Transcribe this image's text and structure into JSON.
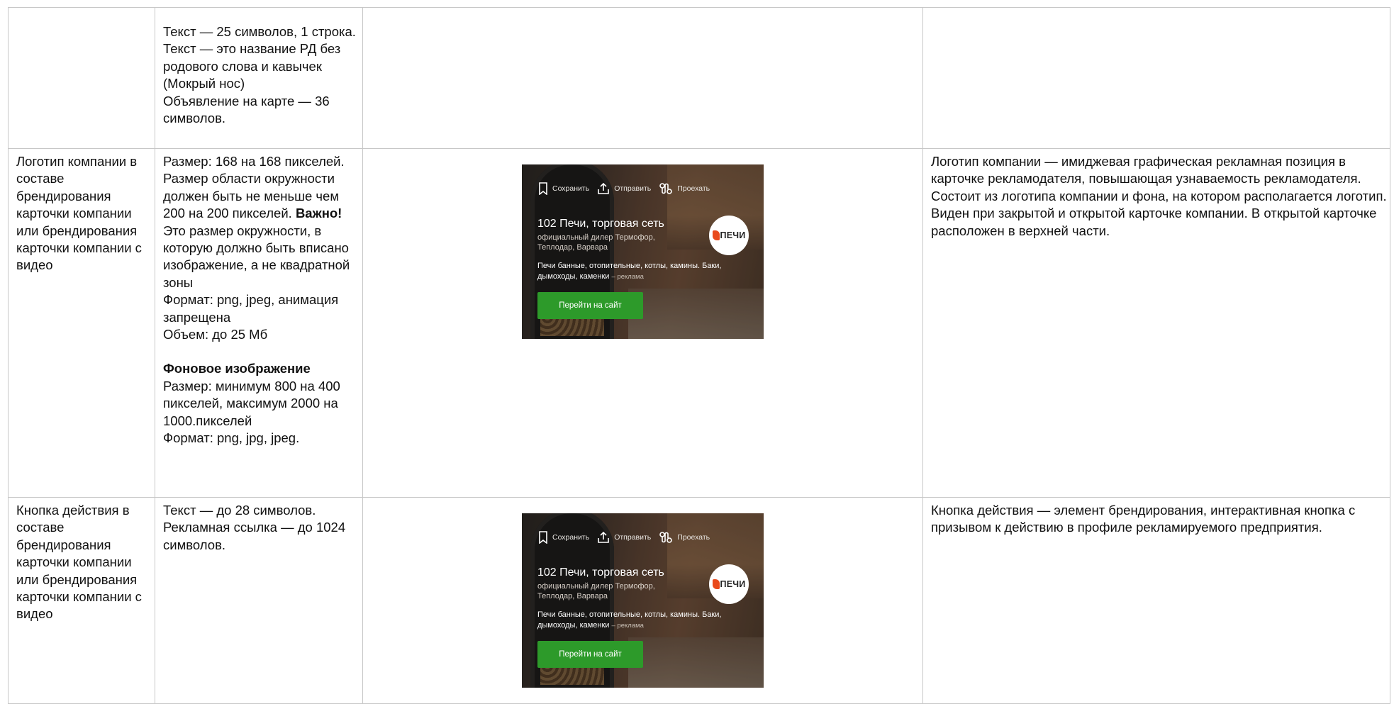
{
  "rows": [
    {
      "col1": "",
      "col2": [
        "Текст — 25 символов, 1 строка. Текст — это название РД без родового слова и кавычек (Мокрый нос)",
        "Объявление на карте — 36 символов."
      ],
      "col4": ""
    },
    {
      "col1": "Логотип компании в составе брендирования карточки компании или брендирования карточки компании с видео",
      "col2": {
        "p1_a": "Размер: 168 на 168 пикселей. Размер области окружности должен быть не меньше чем 200 на 200 пикселей. ",
        "p1_bold": "Важно!",
        "p1_b": " Это размер окружности, в которую должно быть вписано изображение, а не квадратной зоны",
        "p2": "Формат: png, jpeg, анимация запрещена",
        "p3": "Объем: до 25 Мб",
        "bg_heading": "Фоновое изображение",
        "bg_size": "Размер: минимум 800 на 400 пикселей, максимум 2000 на 1000.пикселей",
        "bg_format": "Формат: png, jpg, jpeg."
      },
      "col4": "Логотип компании — имиджевая графическая рекламная позиция в карточке рекламодателя, повышающая узнаваемость рекламодателя. Состоит из логотипа компании и фона, на котором располагается логотип. Виден при закрытой и открытой карточке компании. В открытой карточке расположен в верхней части."
    },
    {
      "col1": "Кнопка действия в составе брендирования карточки компании или брендирования карточки компании с видео",
      "col2": [
        "Текст — до 28 символов.",
        "Рекламная ссылка — до 1024 символов."
      ],
      "col4": "Кнопка действия — элемент брендирования, интерактивная кнопка с призывом к действию в профиле рекламируемого предприятия."
    }
  ],
  "preview": {
    "save": "Сохранить",
    "send": "Отправить",
    "route": "Проехать",
    "title": "102 Печи, торговая сеть",
    "subtitle": "официальный дилер Термофор, Теплодар, Варвара",
    "desc": "Печи банные, отопительные, котлы, камины. Баки, дымоходы, каменки",
    "ad_label": "– реклама",
    "cta": "Перейти на сайт",
    "logo_text": "ПЕЧИ",
    "cta_color": "#2d9a2a"
  }
}
